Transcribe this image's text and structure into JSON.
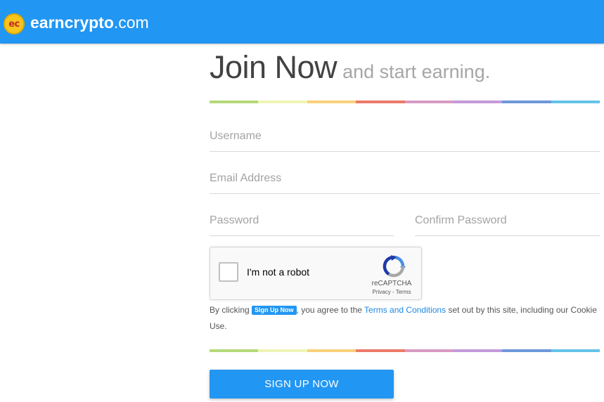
{
  "header": {
    "logo_text": "ec",
    "brand_bold": "earncrypto",
    "brand_light": ".com"
  },
  "page": {
    "title": "Join Now",
    "subtitle": "and start earning."
  },
  "form": {
    "username_placeholder": "Username",
    "email_placeholder": "Email Address",
    "password_placeholder": "Password",
    "confirm_placeholder": "Confirm Password"
  },
  "recaptcha": {
    "label": "I'm not a robot",
    "brand": "reCAPTCHA",
    "privacy": "Privacy",
    "separator": " - ",
    "terms": "Terms"
  },
  "terms_text": {
    "prefix": "By clicking ",
    "chip": "Sign Up Now",
    "middle": ", you agree to the ",
    "link": "Terms and Conditions",
    "suffix": " set out by this site, including our Cookie Use."
  },
  "signup_label": "SIGN UP NOW",
  "colors": {
    "header_bg": "#2196f3",
    "accent": "#2196f3",
    "rainbow": [
      "#b5d97a",
      "#eef5b5",
      "#f9d07a",
      "#ec7968",
      "#d89ac3",
      "#c49ada",
      "#6d98da",
      "#63c3e8"
    ]
  }
}
